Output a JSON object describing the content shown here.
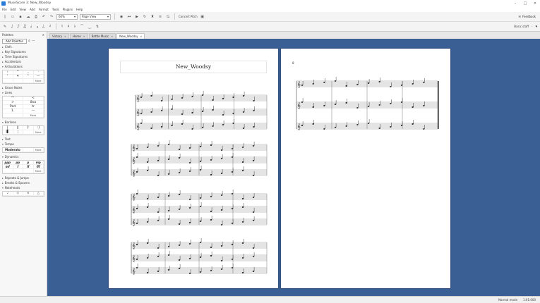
{
  "window": {
    "title": "MuseScore 3: New_Woodsy"
  },
  "menu": [
    "File",
    "Edit",
    "View",
    "Add",
    "Format",
    "Tools",
    "Plugins",
    "Help"
  ],
  "toolbar": {
    "zoom_value": "60%",
    "view_mode": "Page View",
    "concert_pitch": "Concert Pitch",
    "feedback": "Feedback"
  },
  "note_toolbar": {
    "durations": [
      "♩",
      "♪",
      "♫",
      "𝅗𝅥",
      "𝅝",
      "♩.",
      "𝄽",
      "♮",
      "♯",
      "♭"
    ],
    "staves_label": "Basic staff",
    "staves_extra": "-"
  },
  "palette": {
    "title": "Palettes",
    "add_button": "Add Palettes",
    "sections": [
      "Clefs",
      "Key Signatures",
      "Time Signatures",
      "Accidentals",
      "Articulations",
      "Grace Notes",
      "Lines",
      "Barlines",
      "Text",
      "Tempo",
      "Dynamics",
      "Repeats & Jumps",
      "Breaks & Spacers",
      "Noteheads"
    ],
    "articulation_cells": [
      "›",
      "^",
      "_",
      "·",
      "'",
      "▾",
      "⌃",
      "—"
    ],
    "dynamics_cells": [
      "ppp",
      "pp",
      "p",
      "mp",
      "mf",
      "f",
      "ff",
      "fff"
    ],
    "more": "More",
    "tempo_cell": "Moderato"
  },
  "tabs": [
    {
      "label": "Victory"
    },
    {
      "label": "Home"
    },
    {
      "label": "Battle Music"
    },
    {
      "label": "New_Woodsy"
    }
  ],
  "score": {
    "title": "New_Woodsy",
    "page2_system_number": "8"
  },
  "status": {
    "mode": "Normal mode",
    "page": "1:01:000"
  }
}
